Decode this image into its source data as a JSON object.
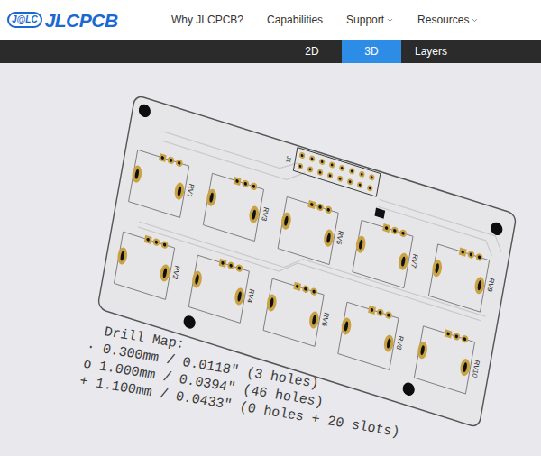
{
  "header": {
    "logo_mark": "J@LC",
    "logo_text": "JLCPCB",
    "nav": [
      {
        "label": "Why JLCPCB?",
        "dropdown": false
      },
      {
        "label": "Capabilities",
        "dropdown": false
      },
      {
        "label": "Support",
        "dropdown": true
      },
      {
        "label": "Resources",
        "dropdown": true
      }
    ]
  },
  "view_tabs": [
    {
      "label": "2D",
      "selected": false
    },
    {
      "label": "3D",
      "selected": true
    },
    {
      "label": "Layers",
      "selected": false
    }
  ],
  "board": {
    "connector": "J1",
    "components": [
      "RV1",
      "RV2",
      "RV3",
      "RV4",
      "RV5",
      "RV6",
      "RV7",
      "RV8",
      "RV9",
      "RV10"
    ]
  },
  "drill_map": {
    "title": "Drill Map:",
    "rows": [
      {
        "symbol": "·",
        "text": "0.300mm / 0.0118\" (3 holes)"
      },
      {
        "symbol": "o",
        "text": "1.000mm / 0.0394\" (46 holes)"
      },
      {
        "symbol": "+",
        "text": "1.100mm / 0.0433\" (0 holes + 20 slots)"
      }
    ]
  }
}
